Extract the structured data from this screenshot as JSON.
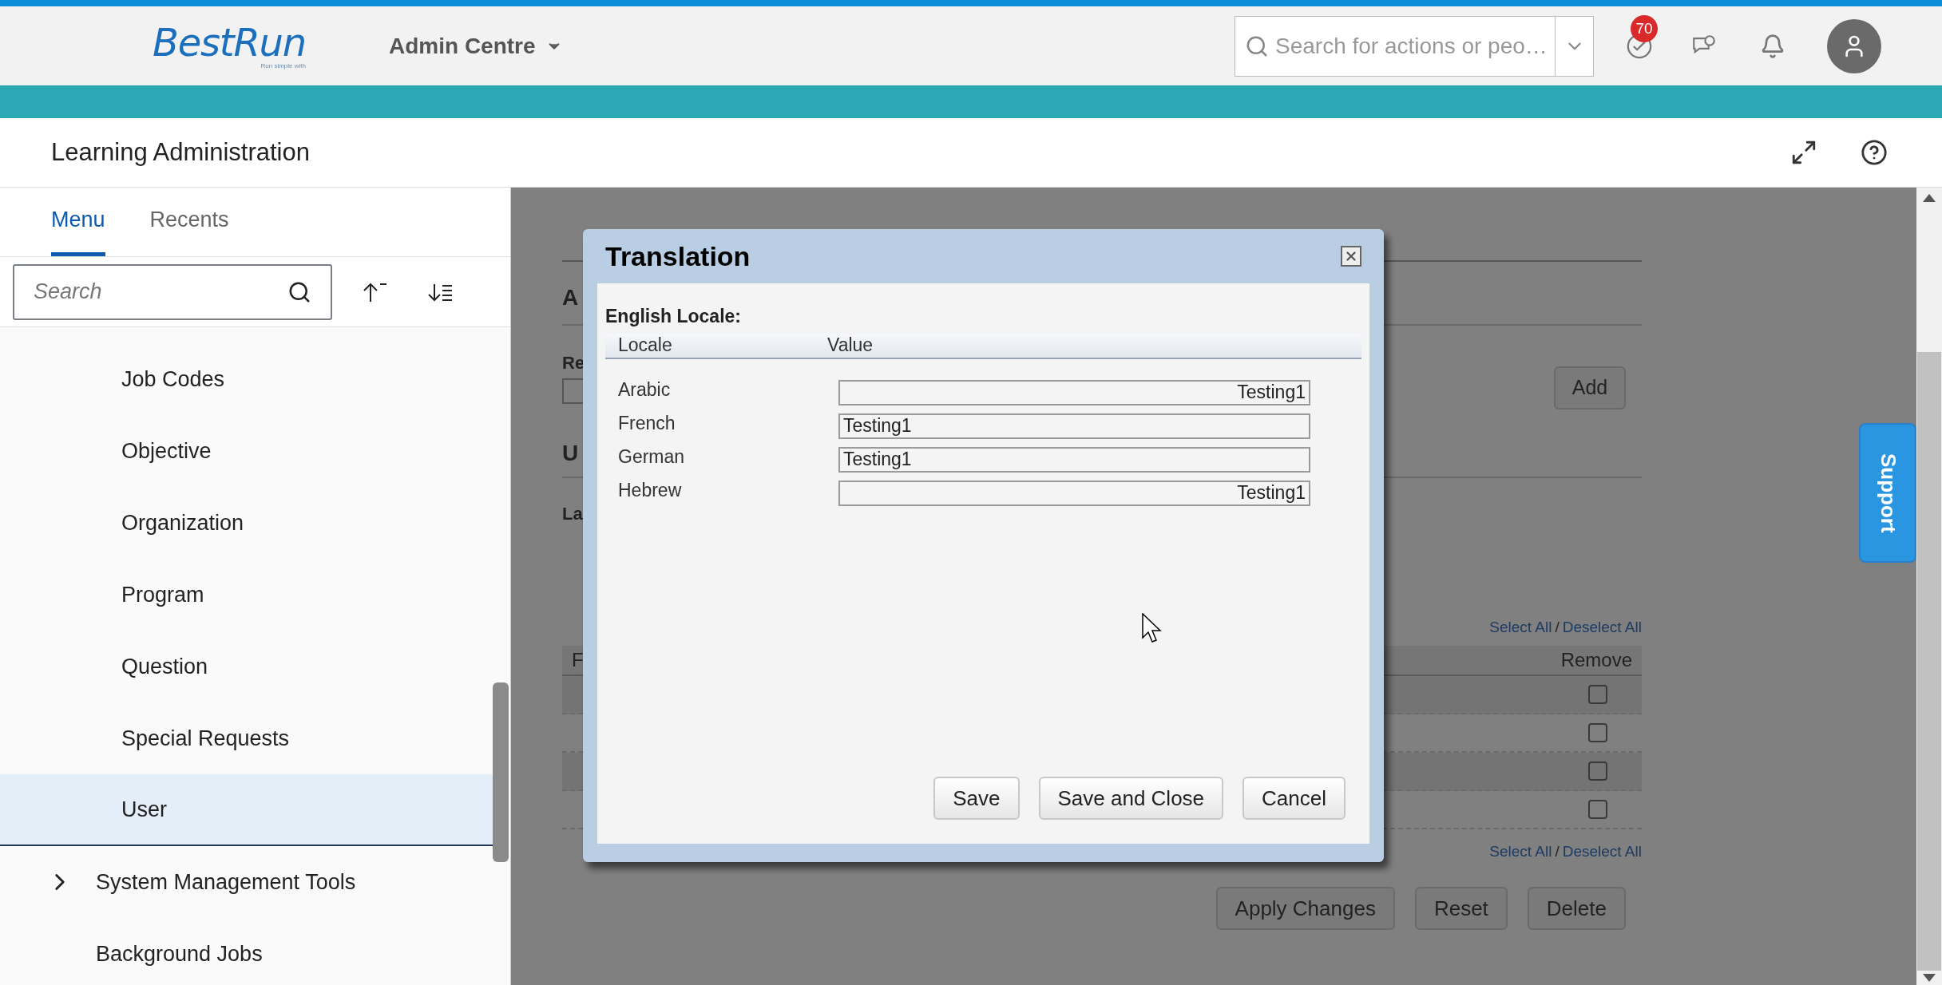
{
  "header": {
    "logo": "BestRun",
    "logo_tagline": "Run simple with",
    "menu_label": "Admin Centre",
    "search": {
      "placeholder": "Search for actions or peo…"
    },
    "badge": "70"
  },
  "page_title": "Learning Administration",
  "sidebar": {
    "tabs": [
      {
        "label": "Menu",
        "selected": true
      },
      {
        "label": "Recents",
        "selected": false
      }
    ],
    "search": {
      "placeholder": "Search"
    },
    "items": [
      {
        "label": "Job Codes",
        "kind": "subitem",
        "selected": false
      },
      {
        "label": "Objective",
        "kind": "subitem",
        "selected": false
      },
      {
        "label": "Organization",
        "kind": "subitem",
        "selected": false
      },
      {
        "label": "Program",
        "kind": "subitem",
        "selected": false
      },
      {
        "label": "Question",
        "kind": "subitem",
        "selected": false
      },
      {
        "label": "Special Requests",
        "kind": "subitem",
        "selected": false
      },
      {
        "label": "User",
        "kind": "subitem",
        "selected": true
      },
      {
        "label": "System Management Tools",
        "kind": "folder",
        "selected": false
      },
      {
        "label": "Background Jobs",
        "kind": "item",
        "selected": false
      }
    ]
  },
  "background": {
    "fragments": [
      "A",
      "Re",
      "U",
      "La"
    ],
    "add_button": "Add",
    "links_top": {
      "select": "Select All",
      "separator": "/",
      "deselect": "Deselect All"
    },
    "table": {
      "column_1": "F",
      "remove_header": "Remove",
      "rows": [
        {
          "checked": false
        },
        {
          "checked": false
        },
        {
          "checked": false
        },
        {
          "checked": false
        }
      ]
    },
    "links_bottom": {
      "select": "Select All",
      "separator": "/",
      "deselect": "Deselect All"
    },
    "buttons": [
      "Apply Changes",
      "Reset",
      "Delete"
    ]
  },
  "dialog": {
    "title": "Translation",
    "section": "English Locale:",
    "columns": [
      "Locale",
      "Value"
    ],
    "rows": [
      {
        "locale": "Arabic",
        "value": "Testing1",
        "kind": "rtl"
      },
      {
        "locale": "French",
        "value": "Testing1",
        "kind": "ltr"
      },
      {
        "locale": "German",
        "value": "Testing1",
        "kind": "ltr"
      },
      {
        "locale": "Hebrew",
        "value": "Testing1",
        "kind": "rtl"
      }
    ],
    "buttons": [
      "Save",
      "Save and Close",
      "Cancel"
    ]
  },
  "support": "Support"
}
